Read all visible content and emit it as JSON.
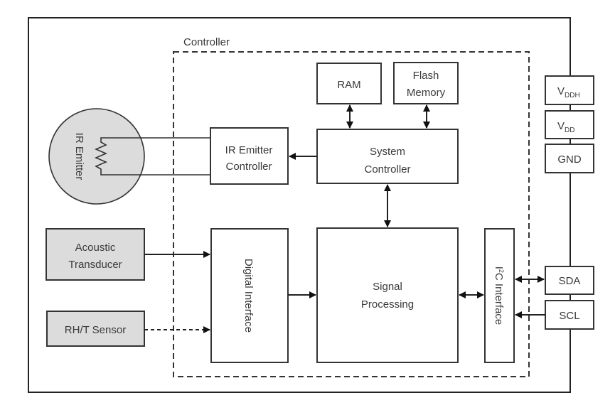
{
  "diagram": {
    "container_label": "Controller",
    "blocks": {
      "ir_emitter": "IR Emitter",
      "ir_emitter_controller": [
        "IR Emitter",
        "Controller"
      ],
      "ram": "RAM",
      "flash_memory": [
        "Flash",
        "Memory"
      ],
      "system_controller": [
        "System",
        "Controller"
      ],
      "acoustic_transducer": [
        "Acoustic",
        "Transducer"
      ],
      "rht_sensor": "RH/T Sensor",
      "digital_interface": "Digital Interface",
      "signal_processing": [
        "Signal",
        "Processing"
      ],
      "i2c_interface": {
        "prefix": "I",
        "sup": "2",
        "suffix": "C Interface"
      }
    },
    "pins": {
      "vddh": {
        "main": "V",
        "sub": "DDH"
      },
      "vdd": {
        "main": "V",
        "sub": "DD"
      },
      "gnd": "GND",
      "sda": "SDA",
      "scl": "SCL"
    },
    "connections": [
      {
        "from": "system_controller",
        "to": "ir_emitter_controller",
        "type": "arrow"
      },
      {
        "from": "ir_emitter_controller",
        "to": "ir_emitter",
        "type": "wire"
      },
      {
        "from": "ram",
        "to": "system_controller",
        "type": "bidirectional"
      },
      {
        "from": "flash_memory",
        "to": "system_controller",
        "type": "bidirectional"
      },
      {
        "from": "system_controller",
        "to": "signal_processing",
        "type": "bidirectional"
      },
      {
        "from": "acoustic_transducer",
        "to": "digital_interface",
        "type": "arrow"
      },
      {
        "from": "rht_sensor",
        "to": "digital_interface",
        "type": "dashed-arrow"
      },
      {
        "from": "digital_interface",
        "to": "signal_processing",
        "type": "arrow"
      },
      {
        "from": "signal_processing",
        "to": "i2c_interface",
        "type": "bidirectional"
      },
      {
        "from": "sda",
        "to": "i2c_interface",
        "type": "bidirectional"
      },
      {
        "from": "scl",
        "to": "i2c_interface",
        "type": "arrow"
      }
    ],
    "colors": {
      "stroke": "#333333",
      "sensor_fill": "#dcdcdc",
      "text": "#3a3a3a"
    }
  }
}
